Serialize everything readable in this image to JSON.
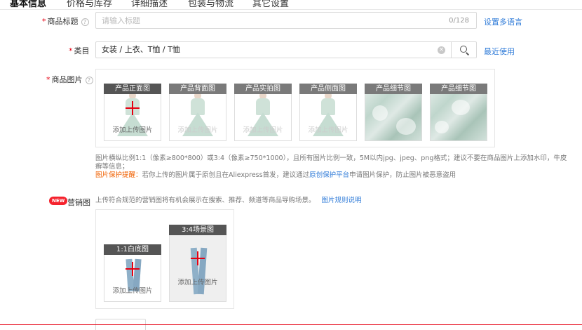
{
  "tabs": [
    "基本信息",
    "价格与库存",
    "详细描述",
    "包装与物流",
    "其它设置"
  ],
  "title_field": {
    "label": "商品标题",
    "placeholder": "请输入标题",
    "counter": "0/128",
    "link": "设置多语言"
  },
  "category": {
    "label": "类目",
    "value": "女装 / 上衣、T恤 / T恤",
    "link": "最近使用"
  },
  "product_images": {
    "label": "商品图片",
    "slots": [
      "产品正面图",
      "产品背面图",
      "产品实拍图",
      "产品侧面图",
      "产品细节图",
      "产品细节图"
    ],
    "upload_text": "添加上传图片",
    "note_line1": "图片横纵比例1:1（像素≥800*800）或3:4（像素≥750*1000），且所有图片比例一致，5M以内jpg、jpeg、png格式；建议不要在商品图片上添加水印，牛皮",
    "note_line2": "癣等信息；",
    "protect_label": "图片保护提醒：",
    "protect_text_a": "若你上传的图片属于原创且在Aliexpress首发，建议通过",
    "protect_link": "原创保护平台",
    "protect_text_b": "申请图片保护，防止图片被恶意盗用"
  },
  "marketing": {
    "badge": "NEW",
    "label": "营销图",
    "desc": "上传符合规范的营销图将有机会展示在搜索、推荐、频道等商品导购场景。",
    "link": "图片规则说明",
    "slots": [
      "1:1白底图",
      "3:4场景图"
    ],
    "upload_text": "添加上传图片"
  },
  "icons": {
    "help": "question-circle-icon",
    "clear": "clear-circle-icon",
    "search": "search-icon",
    "plus": "plus-icon"
  },
  "colors": {
    "accent_red": "#e60012",
    "link_blue": "#2f7bd8",
    "warning_orange": "#f06000"
  }
}
